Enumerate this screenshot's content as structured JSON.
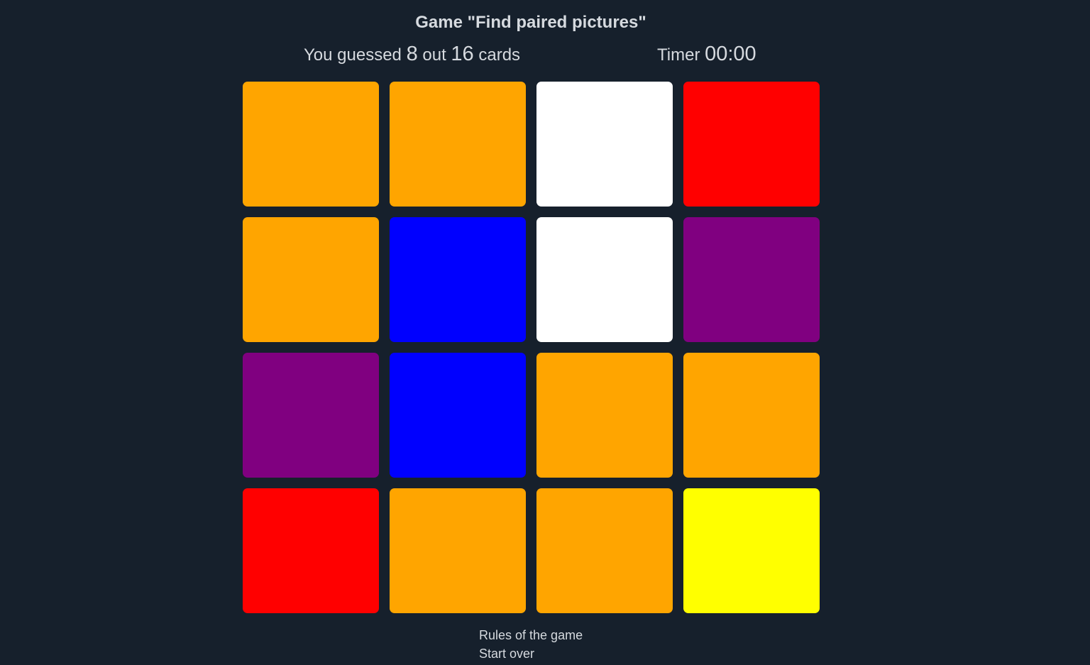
{
  "title": "Game \"Find paired pictures\"",
  "stats": {
    "prefix": "You guessed ",
    "guessed": "8",
    "middle": " out ",
    "total": "16",
    "suffix": " cards"
  },
  "timer": {
    "label": "Timer ",
    "value": "00:00"
  },
  "cards": [
    {
      "color": "#ffa500"
    },
    {
      "color": "#ffa500"
    },
    {
      "color": "#ffffff"
    },
    {
      "color": "#ff0000"
    },
    {
      "color": "#ffa500"
    },
    {
      "color": "#0000ff"
    },
    {
      "color": "#ffffff"
    },
    {
      "color": "#800080"
    },
    {
      "color": "#800080"
    },
    {
      "color": "#0000ff"
    },
    {
      "color": "#ffa500"
    },
    {
      "color": "#ffa500"
    },
    {
      "color": "#ff0000"
    },
    {
      "color": "#ffa500"
    },
    {
      "color": "#ffa500"
    },
    {
      "color": "#ffff00"
    }
  ],
  "links": {
    "rules": "Rules of the game",
    "restart": "Start over"
  }
}
